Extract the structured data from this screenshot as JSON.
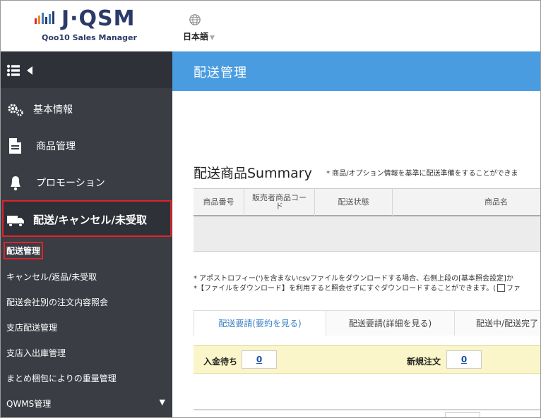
{
  "header": {
    "logo_text": "J·QSM",
    "logo_sub": "Qoo10 Sales Manager",
    "language": "日本語",
    "language_caret": "▼"
  },
  "sidebar": {
    "items": [
      {
        "label": "基本情報",
        "icon": "gears-icon"
      },
      {
        "label": "商品管理",
        "icon": "document-icon"
      },
      {
        "label": "プロモーション",
        "icon": "bell-icon"
      },
      {
        "label": "配送/キャンセル/未受取",
        "icon": "truck-icon"
      }
    ],
    "subitems": [
      {
        "label": "配送管理"
      },
      {
        "label": "キャンセル/返品/未受取"
      },
      {
        "label": "配送会社別の注文内容照会"
      },
      {
        "label": "支店配送管理"
      },
      {
        "label": "支店入出庫管理"
      },
      {
        "label": "まとめ梱包によりの重量管理"
      },
      {
        "label": "QWMS管理",
        "caret": "▼"
      }
    ]
  },
  "main": {
    "page_title": "配送管理",
    "summary_title": "配送商品Summary",
    "summary_note": "* 商品/オプション情報を基準に配送準備をすることができま",
    "table": {
      "headers": [
        "商品番号",
        "販売者商品コード",
        "配送状態",
        "商品名"
      ]
    },
    "note1": "* アポストロフィー(')を含まないcsvファイルをダウンロードする場合、右側上段の[基本照会設定]か",
    "note2_a": "*【ファイルをダウンロード】を利用すると照会せずにすぐダウンロードすることができます。(",
    "note2_b": "ファ",
    "tabs": [
      "配送要請(要約を見る)",
      "配送要請(詳細を見る)",
      "配送中/配送完了"
    ],
    "status": {
      "pending_label": "入金待ち",
      "pending_value": "0",
      "new_label": "新規注文",
      "new_value": "0"
    }
  },
  "colors": {
    "sidebar_bg": "#3a3d44",
    "title_bar": "#4a9ce0",
    "highlight_red": "#e0232a",
    "status_bg": "#fbf6c9"
  }
}
